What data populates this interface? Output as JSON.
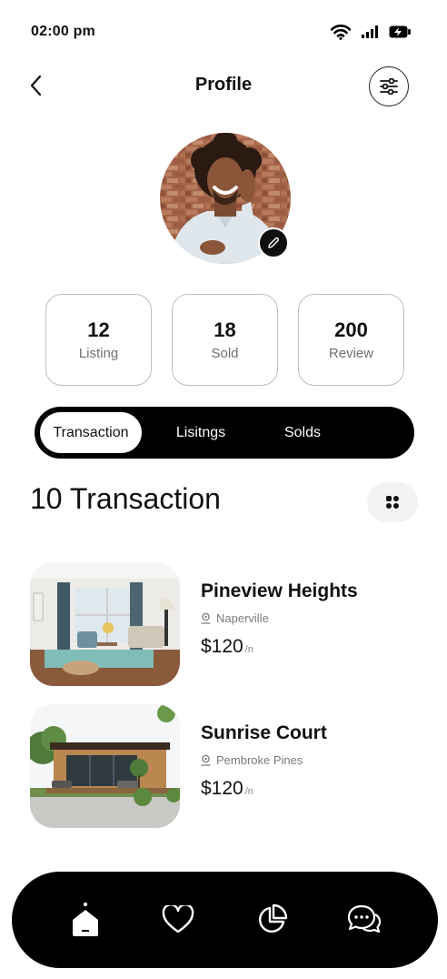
{
  "status_bar": {
    "time": "02:00 pm",
    "icons": [
      "wifi-icon",
      "signal-icon",
      "battery-icon"
    ]
  },
  "header": {
    "title": "Profile",
    "back_icon": "chevron-left-icon",
    "filter_icon": "sliders-icon"
  },
  "profile": {
    "avatar": "profile-photo",
    "edit_icon": "pencil-icon"
  },
  "stats": [
    {
      "value": "12",
      "label": "Listing"
    },
    {
      "value": "18",
      "label": "Sold"
    },
    {
      "value": "200",
      "label": "Review"
    }
  ],
  "tabs": [
    {
      "label": "Transaction",
      "active": true
    },
    {
      "label": "Lisitngs",
      "active": false
    },
    {
      "label": "Solds",
      "active": false
    }
  ],
  "section": {
    "title": "10 Transaction",
    "view_toggle_icon": "grid-dots-icon"
  },
  "properties": [
    {
      "name": "Pineview Heights",
      "location": "Naperville",
      "price": "$120",
      "unit": "/n",
      "image": "living-room-photo"
    },
    {
      "name": "Sunrise Court",
      "location": "Pembroke Pines",
      "price": "$120",
      "unit": "/n",
      "image": "modern-cabin-photo"
    }
  ],
  "bottom_nav": [
    {
      "icon": "home-icon",
      "active": true
    },
    {
      "icon": "heart-icon",
      "active": false
    },
    {
      "icon": "pie-chart-icon",
      "active": false
    },
    {
      "icon": "chat-icon",
      "active": false
    }
  ],
  "colors": {
    "primary": "#000000",
    "background": "#ffffff",
    "border": "#bdbdbd",
    "muted_text": "#6f6f6f"
  }
}
